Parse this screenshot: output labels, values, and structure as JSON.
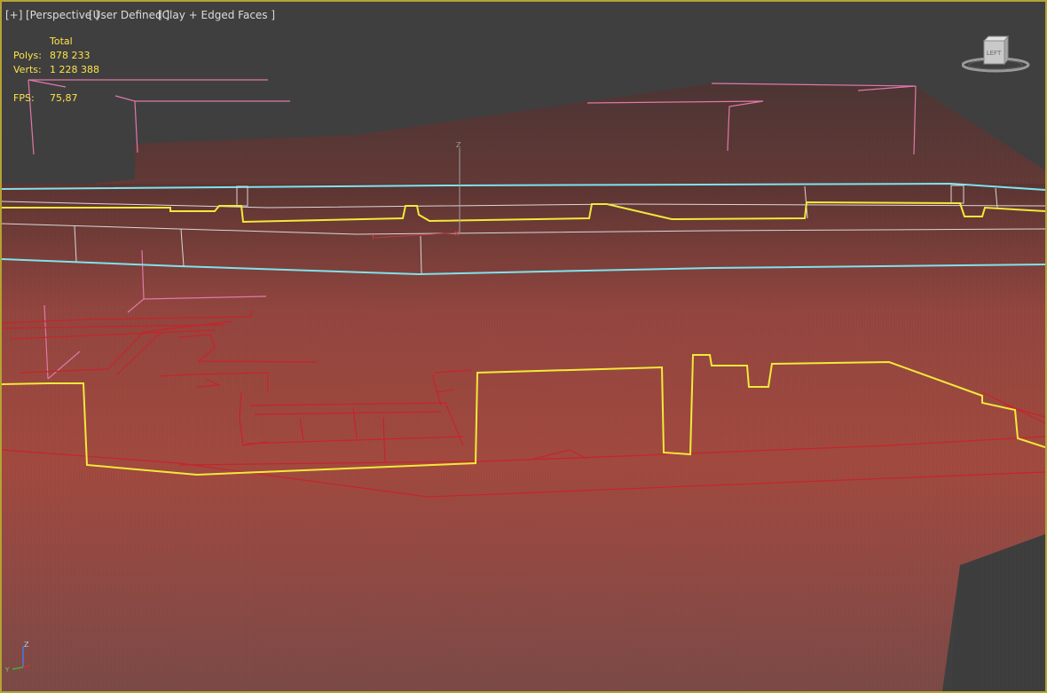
{
  "viewport": {
    "menu": {
      "plus": "[+]",
      "view": "[Perspective ]",
      "camera": "[User Defined ]",
      "shading": "[Clay + Edged Faces ]"
    },
    "stats": {
      "header": "Total",
      "polys_label": "Polys:",
      "polys_value": "878 233",
      "verts_label": "Verts:",
      "verts_value": "1 228 388",
      "fps_label": "FPS:",
      "fps_value": "75,87"
    },
    "viewcube": {
      "face_label": "LEFT"
    },
    "gizmo_labels": {
      "z": "Z",
      "x": "X",
      "y": "Y"
    },
    "tripod": {
      "z": "Z",
      "x": "X",
      "y": "Y"
    },
    "colors": {
      "border": "#b5a233",
      "background": "#3f3f3f",
      "mesh": "#8a3e39",
      "selected_outline": "#f2e93a",
      "cyan_outline": "#7fe3ec",
      "red_wire": "#c6242b",
      "pink_wire": "#e078a8"
    }
  }
}
